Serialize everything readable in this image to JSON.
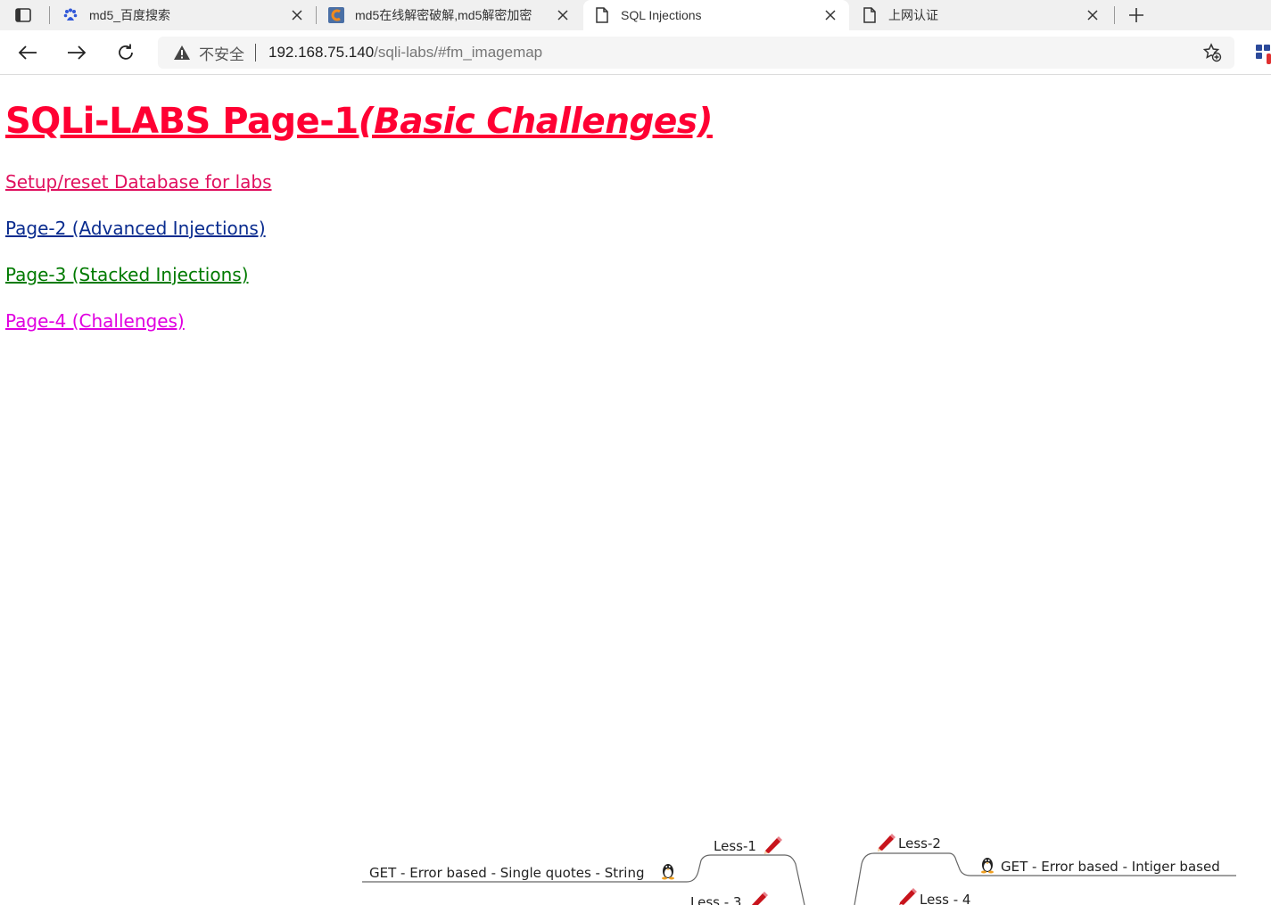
{
  "tabs": [
    {
      "title": "md5_百度搜索",
      "icon": "baidu-paw-icon"
    },
    {
      "title": "md5在线解密破解,md5解密加密",
      "icon": "cmd5-logo-icon"
    },
    {
      "title": "SQL Injections",
      "icon": "page-icon",
      "active": true
    },
    {
      "title": "上网认证",
      "icon": "page-icon"
    }
  ],
  "toolbar": {
    "insecure_label": "不安全",
    "url_host": "192.168.75.140",
    "url_path": "/sqli-labs/#fm_imagemap"
  },
  "page": {
    "heading": "SQLi-LABS Page-1",
    "heading_sub": "(Basic Challenges)",
    "links": [
      {
        "label": "Setup/reset Database for labs",
        "color": "#e0115f"
      },
      {
        "label": "Page-2 (Advanced Injections)",
        "color": "#0a2c8f"
      },
      {
        "label": "Page-3 (Stacked Injections)",
        "color": "#007a00"
      },
      {
        "label": "Page-4 (Challenges)",
        "color": "#e000e0"
      }
    ],
    "heading_color": "#ff0033"
  },
  "mindmap": {
    "less1": "Less-1",
    "less1_desc": "GET - Error based - Single quotes - String",
    "less2": "Less-2",
    "less2_desc": "GET - Error based - Intiger based",
    "less3": "Less - 3",
    "less4": "Less - 4"
  }
}
